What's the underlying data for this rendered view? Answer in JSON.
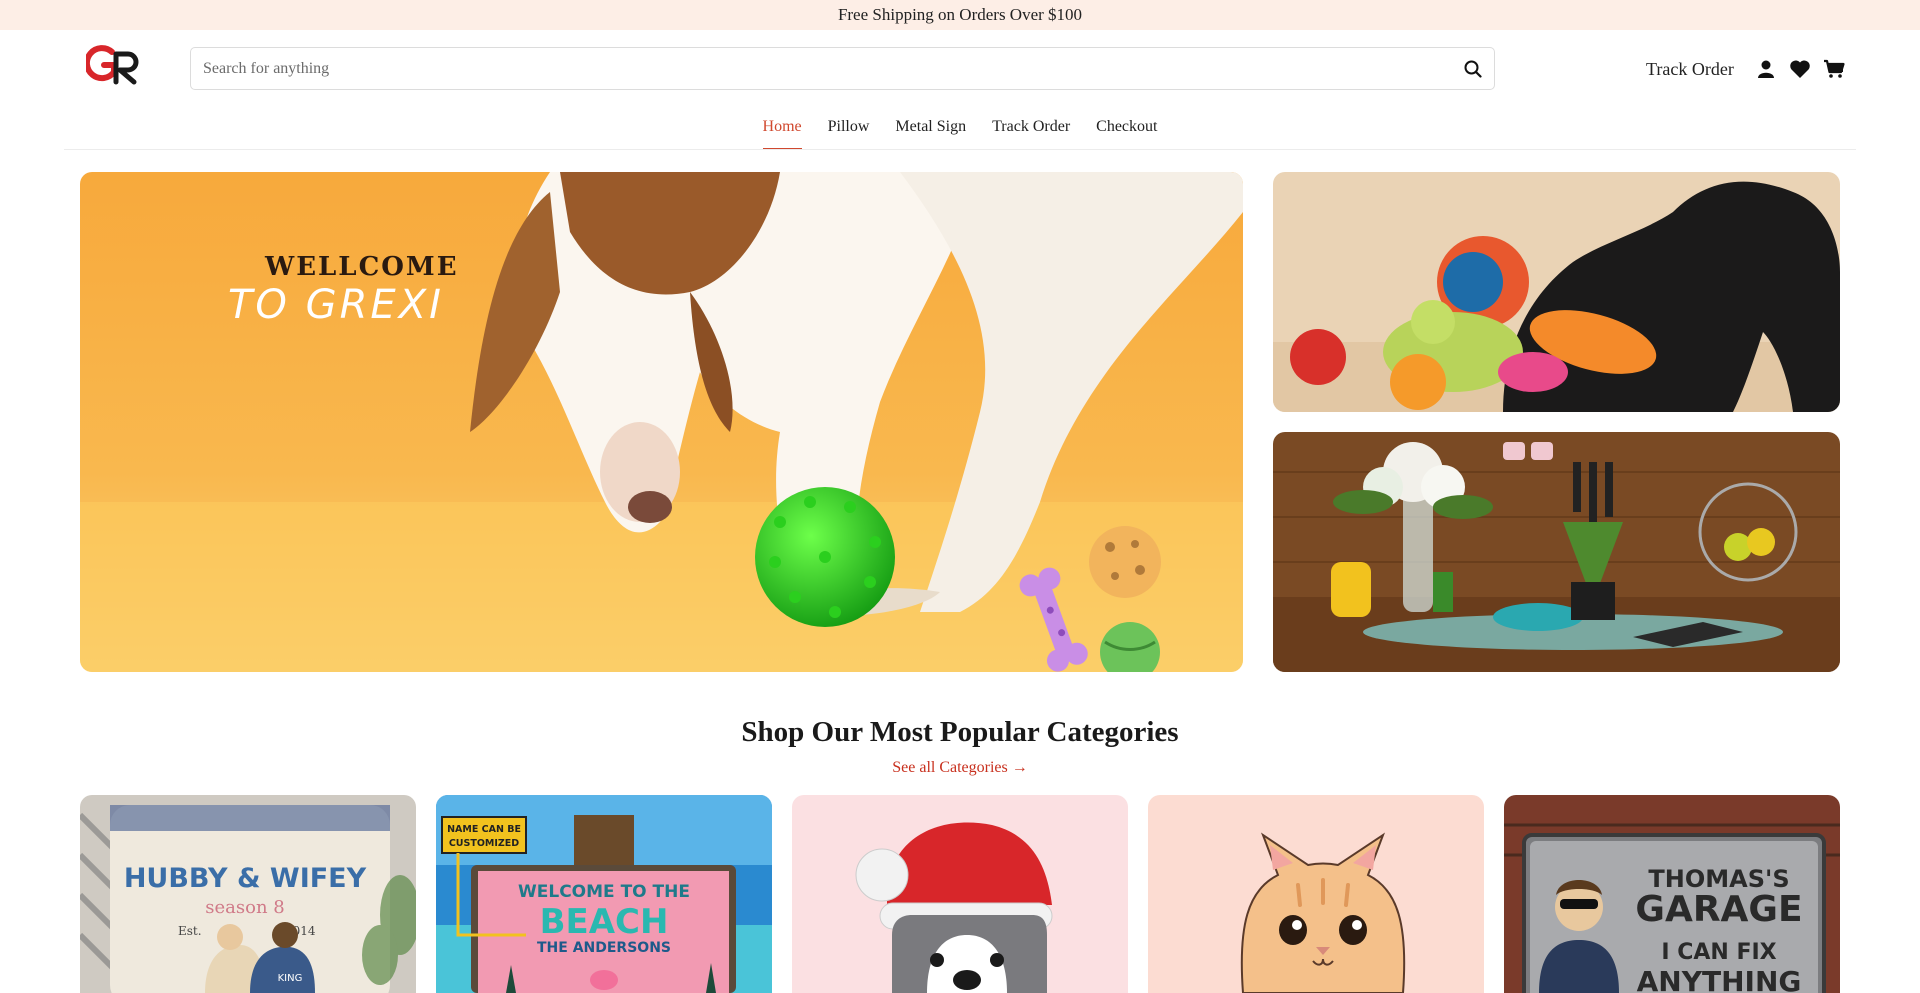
{
  "announcement": "Free Shipping on Orders Over $100",
  "search": {
    "placeholder": "Search for anything"
  },
  "header": {
    "track_order": "Track Order"
  },
  "nav": [
    {
      "label": "Home",
      "active": true
    },
    {
      "label": "Pillow",
      "active": false
    },
    {
      "label": "Metal Sign",
      "active": false
    },
    {
      "label": "Track Order",
      "active": false
    },
    {
      "label": "Checkout",
      "active": false
    }
  ],
  "hero": {
    "line1": "WELLCOME",
    "line2": "TO GREXI"
  },
  "categories_section": {
    "title": "Shop Our Most Popular Categories",
    "see_all": "See all Categories →"
  },
  "category_cards": {
    "pillow": {
      "line1": "HUBBY & WIFEY",
      "line2": "season 8",
      "est": "Est.",
      "year": "2014",
      "shirt": "KING"
    },
    "beach": {
      "badge1": "NAME CAN BE",
      "badge2": "CUSTOMIZED",
      "line1": "WELCOME TO THE",
      "line2": "BEACH",
      "line3": "THE ANDERSONS"
    },
    "garage": {
      "line1": "THOMAS'S",
      "line2": "GARAGE",
      "line3": "I CAN FIX",
      "line4": "ANYTHING"
    }
  },
  "colors": {
    "accent": "#d0482e",
    "announce_bg": "#fdeee6",
    "link_red": "#c8301e"
  },
  "icons": [
    "logo-icon",
    "search-icon",
    "user-icon",
    "heart-icon",
    "cart-icon",
    "arrow-right-icon"
  ]
}
